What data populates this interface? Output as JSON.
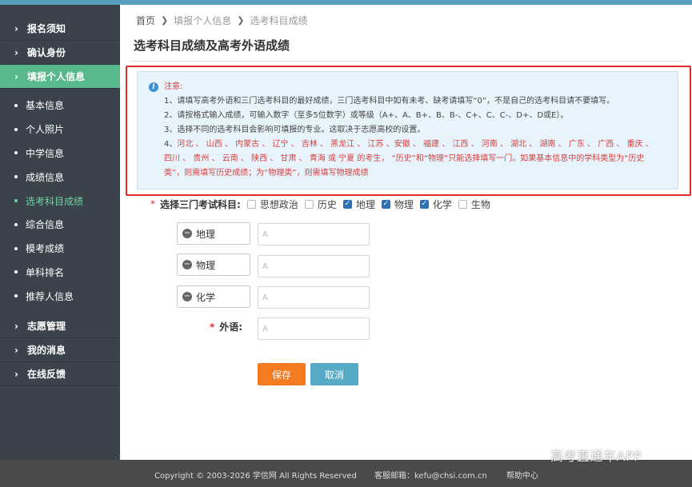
{
  "sidebar": {
    "top": [
      {
        "label": "报名须知"
      },
      {
        "label": "确认身份"
      },
      {
        "label": "填报个人信息"
      }
    ],
    "sub": [
      {
        "label": "基本信息"
      },
      {
        "label": "个人照片"
      },
      {
        "label": "中学信息"
      },
      {
        "label": "成绩信息"
      },
      {
        "label": "选考科目成绩"
      },
      {
        "label": "综合信息"
      },
      {
        "label": "模考成绩"
      },
      {
        "label": "单科排名"
      },
      {
        "label": "推荐人信息"
      }
    ],
    "bottom": [
      {
        "label": "志愿管理"
      },
      {
        "label": "我的消息"
      },
      {
        "label": "在线反馈"
      }
    ]
  },
  "breadcrumb": {
    "home": "首页",
    "level2": "填报个人信息",
    "level3": "选考科目成绩"
  },
  "page_title": "选考科目成绩及高考外语成绩",
  "notice": {
    "head": "注意:",
    "line1": "1、请填写高考外语和三门选考科目的最好成绩，三门选考科目中如有未考、缺考请填写“0”，不是自己的选考科目请不要填写。",
    "line2": "2、请按格式输入成绩，可输入数字（至多5位数字）或等级（A+、A、B+、B、B-、C+、C、C-、D+、D或E）。",
    "line3": "3、选择不同的选考科目会影响可填报的专业。这取决于志愿高校的设置。",
    "line4_prefix": "4、",
    "line4a": "河北 、 山西 、 内蒙古 、 辽宁 、 吉林 、 黑龙江 、 江苏 、安徽 、 福建 、 江西 、 河南 、 湖北 、 湖南 、 广东 、 广西 、 重庆 、",
    "line4b": "四川 、 贵州 、 云南 、 陕西 、 甘肃 、 青海 或 宁夏 的考生， “历史”和“物理”只能选择填写一门。如果基本信息中的学科类型为“历史",
    "line4c": "类”，则需填写历史成绩；为“物理类”，则需填写物理成绩"
  },
  "subject_select": {
    "required_mark": "*",
    "label": "选择三门考试科目:",
    "options": [
      {
        "label": "思想政治",
        "checked": false
      },
      {
        "label": "历史",
        "checked": false
      },
      {
        "label": "地理",
        "checked": true
      },
      {
        "label": "物理",
        "checked": true
      },
      {
        "label": "化学",
        "checked": true
      },
      {
        "label": "生物",
        "checked": false
      }
    ]
  },
  "scores": [
    {
      "subject": "地理",
      "value": "A"
    },
    {
      "subject": "物理",
      "value": "A"
    },
    {
      "subject": "化学",
      "value": "A"
    }
  ],
  "foreign": {
    "required_mark": "*",
    "label": "外语:",
    "value": "A"
  },
  "buttons": {
    "save": "保存",
    "cancel": "取消"
  },
  "footer": {
    "copyright": "Copyright © 2003-2026 学信网 All Rights Reserved",
    "email": "客服邮箱：kefu@chsi.com.cn",
    "help": "帮助中心"
  },
  "watermark": "高考直通车APP",
  "colors": {
    "sidebar_bg": "#3a434b",
    "sidebar_active": "#57b98c",
    "save_button": "#f47b20",
    "cancel_button": "#57aac6",
    "notice_highlight": "#e02b2b"
  }
}
